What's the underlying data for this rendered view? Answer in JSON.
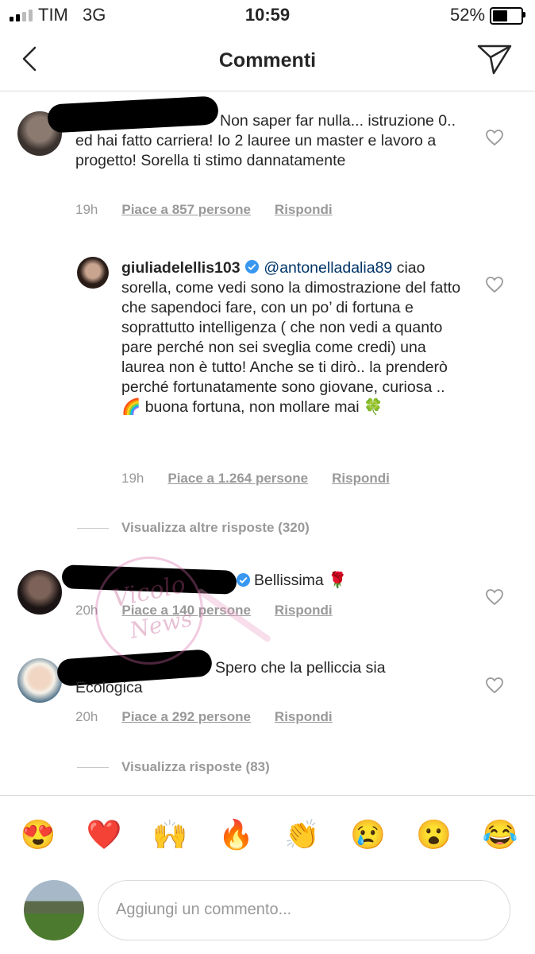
{
  "status": {
    "carrier": "TIM",
    "network": "3G",
    "time": "10:59",
    "battery_pct": "52%",
    "battery_level": 0.52
  },
  "nav": {
    "title": "Commenti",
    "back_icon": "chevron-left-icon",
    "send_icon": "paper-plane-icon"
  },
  "comments": [
    {
      "text": "Non saper far nulla... istruzione 0.. ed hai fatto carriera! Io 2 lauree un master e lavoro a progetto! Sorella ti stimo dannatamente",
      "age": "19h",
      "likes": "Piace a 857 persone",
      "reply": "Rispondi"
    },
    {
      "username": "giuliadelellis103",
      "mention": "@antonelladalia89",
      "text": "ciao sorella, come vedi sono la dimostrazione del fatto che sapendoci fare, con un po’ di fortuna e soprattutto intelligenza ( che non vedi a quanto pare perché non sei sveglia come credi) una laurea non è tutto! Anche se ti dirò.. la prenderò  perché fortunatamente sono giovane, curiosa .. 🌈 buona fortuna, non mollare mai 🍀",
      "age": "19h",
      "likes": "Piace a 1.264 persone",
      "reply": "Rispondi"
    },
    {
      "text": "Bellissima 🌹",
      "age": "20h",
      "likes": "Piace a 140 persone",
      "reply": "Rispondi"
    },
    {
      "text": "Spero che la pelliccia sia Ecologica",
      "age": "20h",
      "likes": "Piace a 292 persone",
      "reply": "Rispondi"
    }
  ],
  "view_more_1": "Visualizza altre risposte (320)",
  "view_more_2": "Visualizza risposte (83)",
  "emojis": [
    "😍",
    "❤️",
    "🙌",
    "🔥",
    "👏",
    "😢",
    "😮",
    "😂"
  ],
  "input": {
    "placeholder": "Aggiungi un commento..."
  },
  "watermark": {
    "text_1": "Vicolo",
    "text_2": "News"
  },
  "colors": {
    "verified": "#3897f0",
    "mention": "#003569",
    "muted": "#999999"
  }
}
